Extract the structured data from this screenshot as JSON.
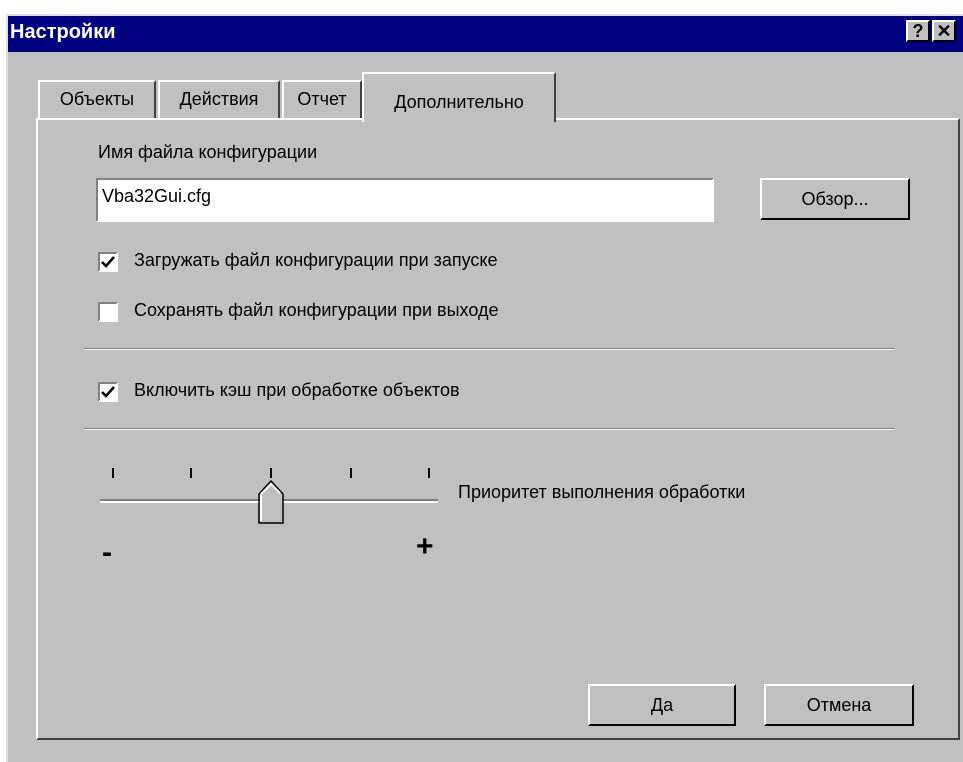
{
  "window": {
    "title": "Настройки",
    "help_glyph": "?",
    "close_glyph": "✕"
  },
  "tabs": [
    {
      "label": "Объекты",
      "active": false
    },
    {
      "label": "Действия",
      "active": false
    },
    {
      "label": "Отчет",
      "active": false
    },
    {
      "label": "Дополнительно",
      "active": true
    }
  ],
  "config": {
    "label": "Имя файла конфигурации",
    "filename": "Vba32Gui.cfg",
    "browse_label": "Обзор..."
  },
  "options": {
    "load_on_start": {
      "label": "Загружать файл конфигурации при запуске",
      "checked": true
    },
    "save_on_exit": {
      "label": "Сохранять файл конфигурации при выходе",
      "checked": false
    },
    "enable_cache": {
      "label": "Включить кэш при обработке объектов",
      "checked": true
    }
  },
  "priority": {
    "label": "Приоритет выполнения обработки",
    "min_label": "-",
    "max_label": "+",
    "level": 2,
    "level_count": 5
  },
  "footer": {
    "ok_label": "Да",
    "cancel_label": "Отмена"
  },
  "colors": {
    "title_bar": "#000080",
    "face": "#c0c0c0"
  },
  "icons": {
    "checkmark": "check-icon",
    "help": "help-icon",
    "close": "close-icon"
  }
}
